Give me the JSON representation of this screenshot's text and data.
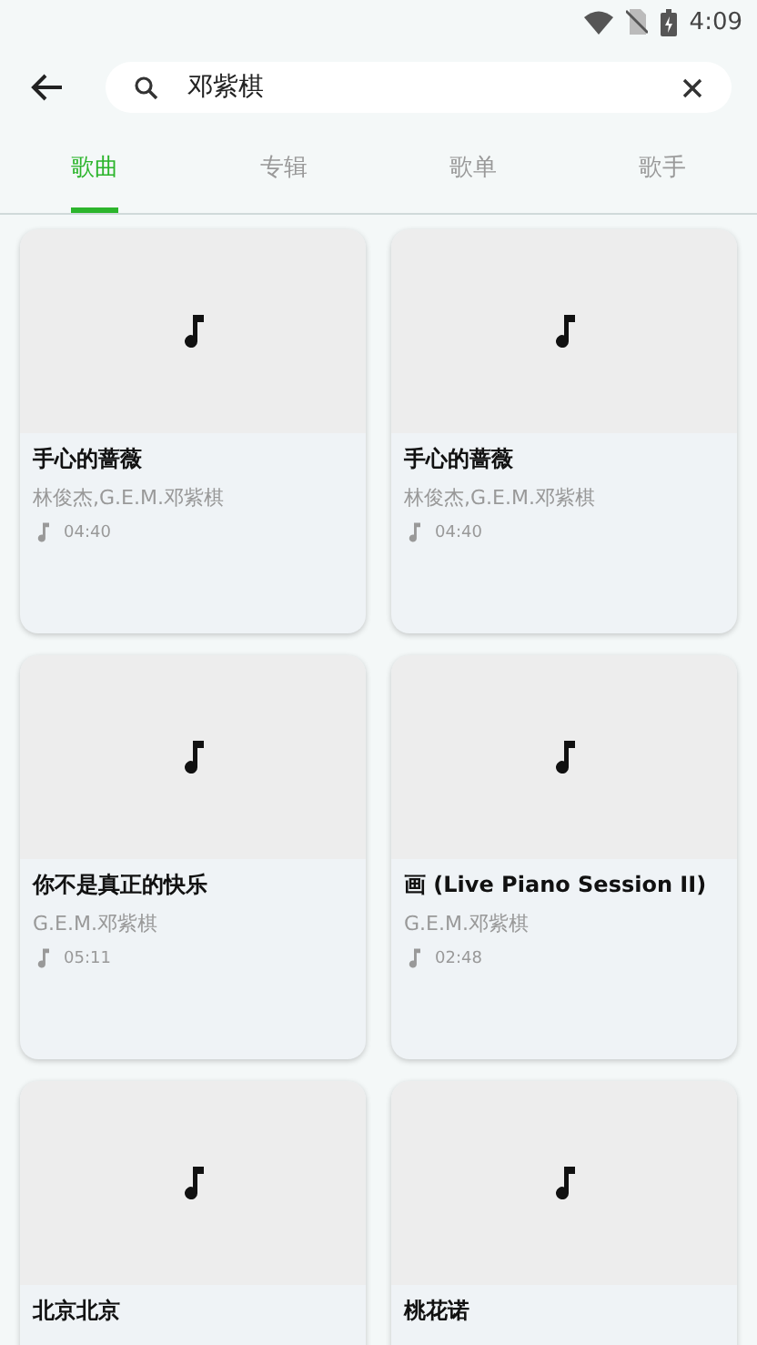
{
  "status_bar": {
    "time": "4:09"
  },
  "search": {
    "value": "邓紫棋"
  },
  "tabs": [
    {
      "label": "歌曲",
      "selected": true
    },
    {
      "label": "专辑",
      "selected": false
    },
    {
      "label": "歌单",
      "selected": false
    },
    {
      "label": "歌手",
      "selected": false
    }
  ],
  "songs": [
    {
      "title": "手心的蔷薇",
      "artist": "林俊杰,G.E.M.邓紫棋",
      "duration": "04:40"
    },
    {
      "title": "手心的蔷薇",
      "artist": "林俊杰,G.E.M.邓紫棋",
      "duration": "04:40"
    },
    {
      "title": "你不是真正的快乐",
      "artist": "G.E.M.邓紫棋",
      "duration": "05:11"
    },
    {
      "title": "画 (Live Piano Session II)",
      "artist": "G.E.M.邓紫棋",
      "duration": "02:48"
    },
    {
      "title": "北京北京"
    },
    {
      "title": "桃花诺"
    }
  ]
}
